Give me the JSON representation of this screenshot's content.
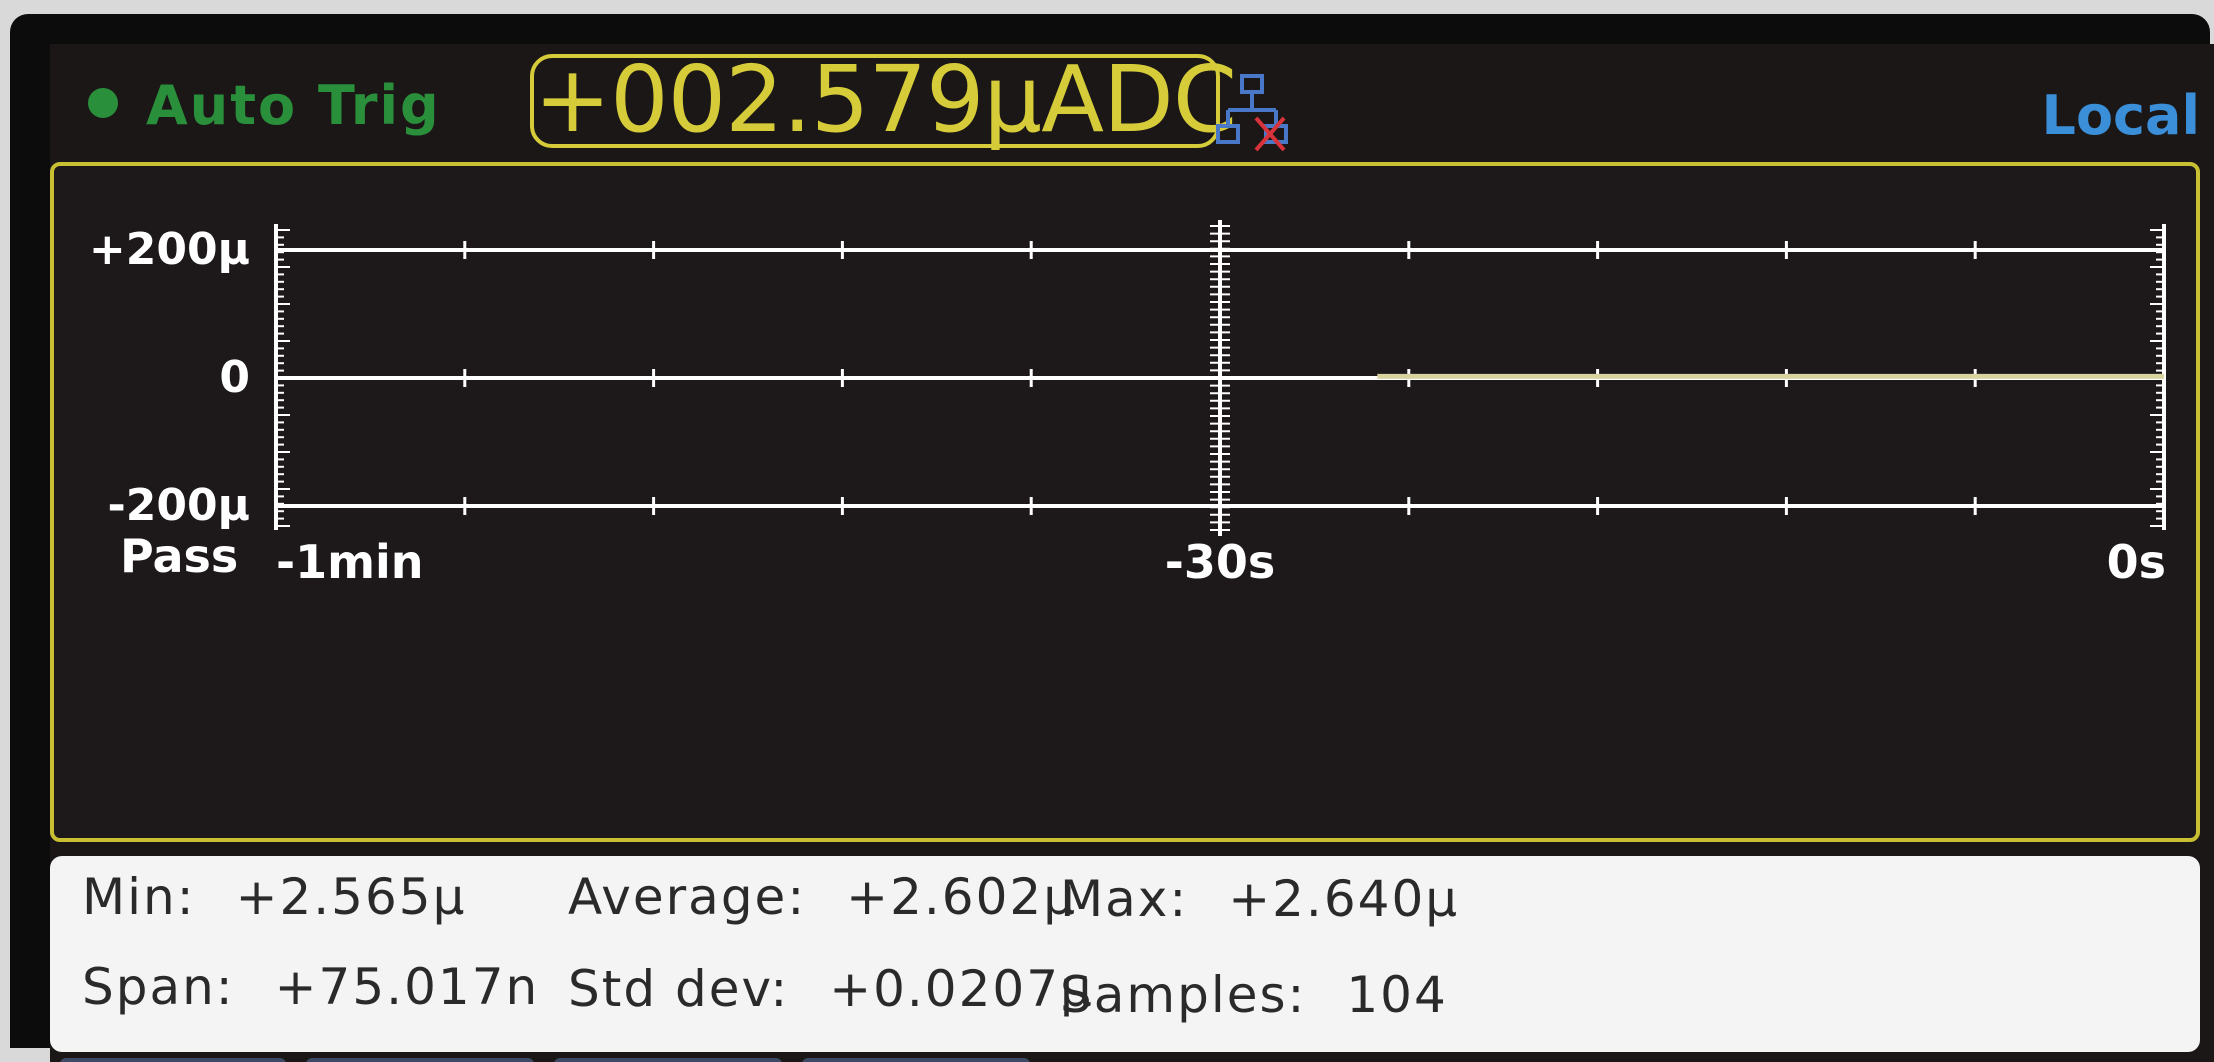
{
  "status": {
    "trigger_label": "Auto Trig",
    "reading": "+002.579",
    "reading_unit": "μADC",
    "remote_state": "Local"
  },
  "chart_data": {
    "type": "line",
    "x_labels": [
      "-1min",
      "-30s",
      "0s"
    ],
    "x_range_seconds": [
      -60,
      0
    ],
    "y_labels": [
      "+200μ",
      "0",
      "-200μ"
    ],
    "ylim": [
      -0.0002,
      0.0002
    ],
    "series": [
      {
        "x": [
          -25,
          0
        ],
        "y": [
          2.6e-06,
          2.6e-06
        ],
        "color": "#d8d4a0"
      }
    ],
    "status_label": "Pass",
    "grid": true
  },
  "stats": {
    "min_label": "Min:",
    "min_value": "+2.565μ",
    "avg_label": "Average:",
    "avg_value": "+2.602μ",
    "max_label": "Max:",
    "max_value": "+2.640μ",
    "span_label": "Span:",
    "span_value": "+75.017n",
    "std_label": "Std dev:",
    "std_value": "+0.0207μ",
    "samples_label": "Samples:",
    "samples_value": "104"
  },
  "colors": {
    "trigger": "#2a8f3a",
    "reading": "#d6cc3a",
    "remote": "#3a8fd8",
    "graph_border": "#c8bf32",
    "axis": "#ffffff"
  },
  "icons": {
    "trigger_indicator": "status-dot-icon",
    "network": "lan-disconnected-icon"
  }
}
